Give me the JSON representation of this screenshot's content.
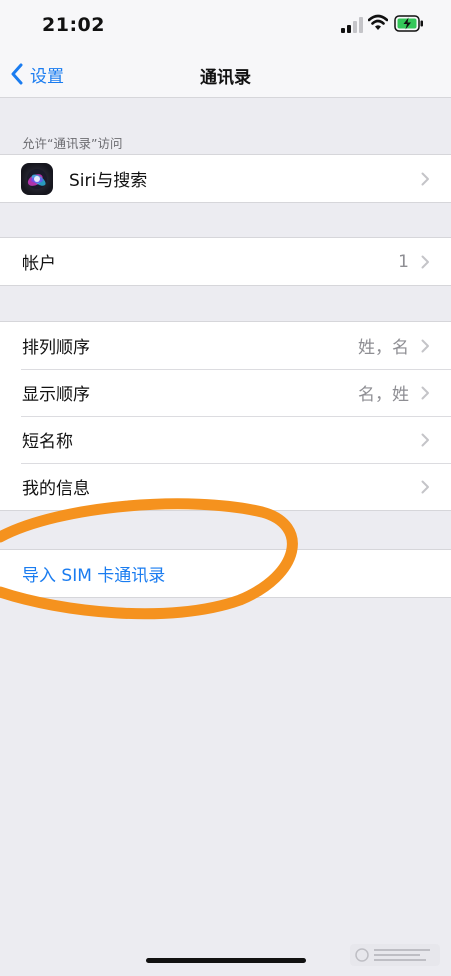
{
  "status_bar": {
    "time": "21:02"
  },
  "nav": {
    "back_label": "设置",
    "title": "通讯录"
  },
  "section_header": "允许“通讯录”访问",
  "siri_row": {
    "label": "Siri与搜索"
  },
  "accounts_row": {
    "label": "帐户",
    "value": "1"
  },
  "settings_rows": [
    {
      "label": "排列顺序",
      "value": "姓，名"
    },
    {
      "label": "显示顺序",
      "value": "名，姓"
    },
    {
      "label": "短名称",
      "value": ""
    },
    {
      "label": "我的信息",
      "value": ""
    }
  ],
  "import_row": {
    "label": "导入 SIM 卡通讯录"
  },
  "annotation": {
    "color": "#f5921e"
  },
  "colors": {
    "accent": "#1a7cf0",
    "background": "#ececf1"
  }
}
